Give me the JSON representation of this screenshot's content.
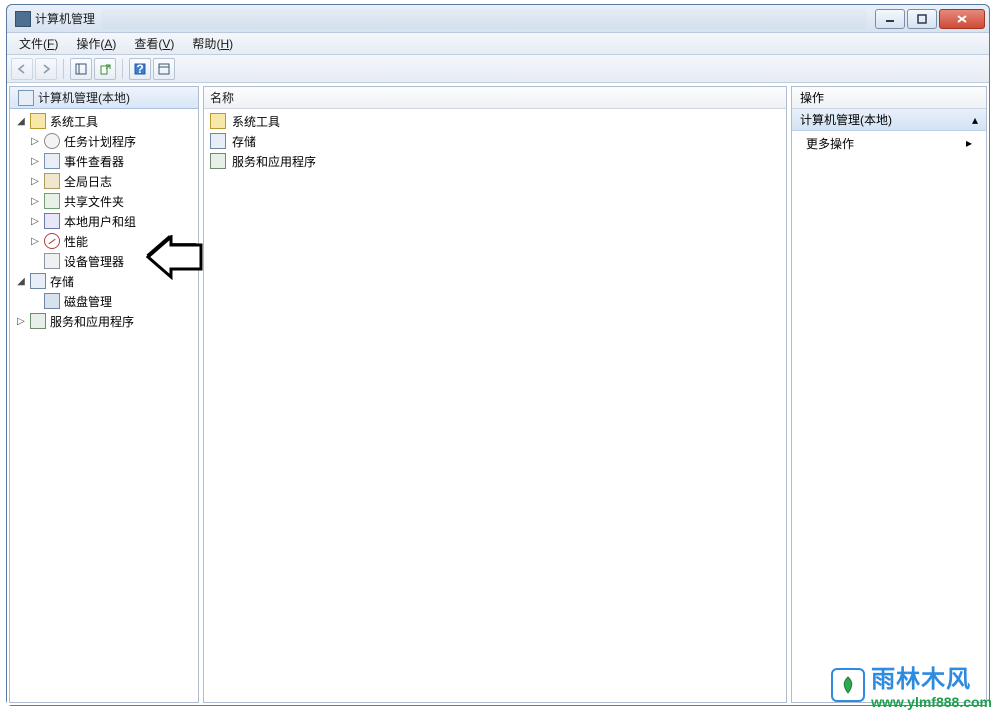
{
  "window": {
    "title": "计算机管理"
  },
  "menu": {
    "file": {
      "label": "文件",
      "accel": "F"
    },
    "action": {
      "label": "操作",
      "accel": "A"
    },
    "view": {
      "label": "查看",
      "accel": "V"
    },
    "help": {
      "label": "帮助",
      "accel": "H"
    }
  },
  "left": {
    "header": "计算机管理(本地)",
    "nodes": {
      "system_tools": "系统工具",
      "task_sched": "任务计划程序",
      "event_viewer": "事件查看器",
      "global_log": "全局日志",
      "shared": "共享文件夹",
      "local_users": "本地用户和组",
      "perf": "性能",
      "devmgr": "设备管理器",
      "storage": "存储",
      "diskmgmt": "磁盘管理",
      "services": "服务和应用程序"
    }
  },
  "mid": {
    "header": "名称",
    "rows": {
      "system_tools": "系统工具",
      "storage": "存储",
      "services": "服务和应用程序"
    }
  },
  "right": {
    "header": "操作",
    "group": "计算机管理(本地)",
    "more": "更多操作"
  },
  "watermark": {
    "brand": "雨林木风",
    "url": "www.ylmf888.com"
  }
}
